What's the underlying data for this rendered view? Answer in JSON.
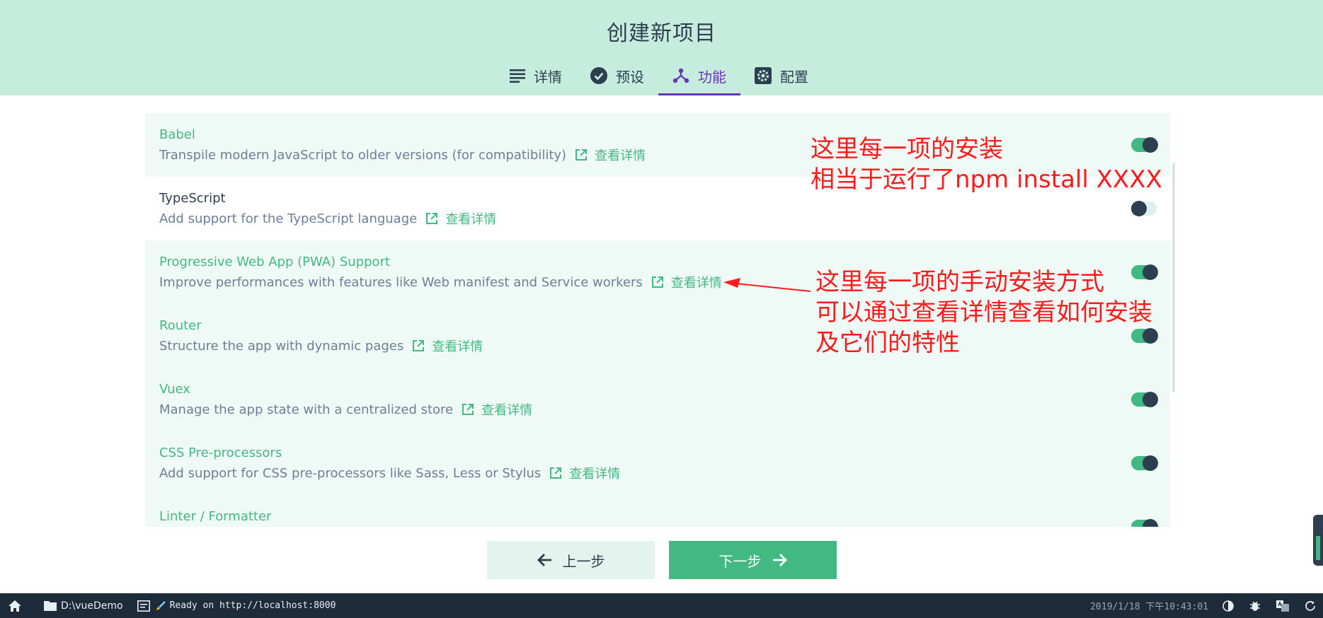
{
  "header": {
    "title": "创建新项目",
    "tabs": [
      {
        "label": "详情",
        "icon": "list-icon"
      },
      {
        "label": "预设",
        "icon": "check-circle-icon"
      },
      {
        "label": "功能",
        "icon": "fork-icon",
        "active": true
      },
      {
        "label": "配置",
        "icon": "gear-icon"
      }
    ]
  },
  "features": [
    {
      "name": "Babel",
      "desc": "Transpile modern JavaScript to older versions (for compatibility)",
      "link": "查看详情",
      "enabled": true
    },
    {
      "name": "TypeScript",
      "desc": "Add support for the TypeScript language",
      "link": "查看详情",
      "enabled": false
    },
    {
      "name": "Progressive Web App (PWA) Support",
      "desc": "Improve performances with features like Web manifest and Service workers",
      "link": "查看详情",
      "enabled": true
    },
    {
      "name": "Router",
      "desc": "Structure the app with dynamic pages",
      "link": "查看详情",
      "enabled": true
    },
    {
      "name": "Vuex",
      "desc": "Manage the app state with a centralized store",
      "link": "查看详情",
      "enabled": true
    },
    {
      "name": "CSS Pre-processors",
      "desc": "Add support for CSS pre-processors like Sass, Less or Stylus",
      "link": "查看详情",
      "enabled": true
    },
    {
      "name": "Linter / Formatter",
      "desc": "",
      "link": "",
      "enabled": true
    }
  ],
  "annotations": {
    "top_line1": "这里每一项的安装",
    "top_line2": "相当于运行了npm install XXXX",
    "mid_line1": "这里每一项的手动安装方式",
    "mid_line2": "可以通过查看详情查看如何安装",
    "mid_line3": "及它们的特性"
  },
  "buttons": {
    "prev": "上一步",
    "next": "下一步"
  },
  "statusbar": {
    "folder": "D:\\vueDemo",
    "status": "Ready on http://localhost:8000",
    "time": "2019/1/18 下午10:43:01"
  },
  "colors": {
    "accent": "#42b983",
    "header_bg": "#c6ecde",
    "active_tab": "#6a35b8",
    "annotation": "#ff1b1b",
    "statusbar_bg": "#1d2b3a"
  }
}
